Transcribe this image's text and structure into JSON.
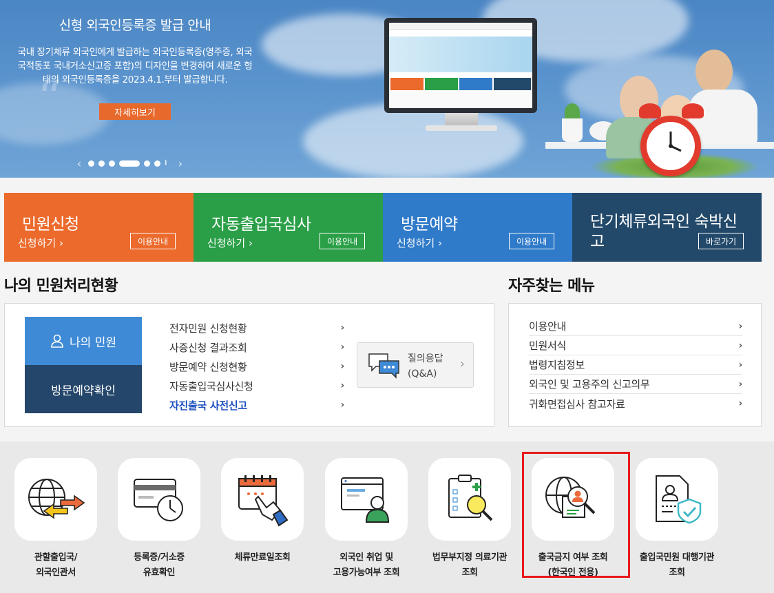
{
  "hero": {
    "title": "신형 외국인등록증 발급 안내",
    "description": "국내 장기체류 외국인에게 발급하는 외국인등록증(영주증, 외국국적동포 국내거소신고증 포함)의 디자인을 변경하여 새로운 형태의 외국인등록증을 2023.4.1.부터 발급합니다.",
    "detail_button": "자세히보기",
    "prev": "‹",
    "next": "›",
    "pause": "ll"
  },
  "tiles": [
    {
      "title": "민원신청",
      "sub": "신청하기 ›",
      "button": "이용안내",
      "color": "#ec6a2c"
    },
    {
      "title": "자동출입국심사",
      "sub": "신청하기 ›",
      "button": "이용안내",
      "color": "#2a9f47"
    },
    {
      "title": "방문예약",
      "sub": "신청하기 ›",
      "button": "이용안내",
      "color": "#2f7ac9"
    },
    {
      "title": "단기체류외국인 숙박신고",
      "button": "바로가기",
      "color": "#23496a"
    }
  ],
  "my_status": {
    "heading": "나의 민원처리현황",
    "my_civil": "나의 민원",
    "visit_confirm": "방문예약확인",
    "links": [
      "전자민원 신청현황",
      "사증신청 결과조회",
      "방문예약 신청현황",
      "자동출입국심사신청",
      "자진출국 사전신고"
    ],
    "qa_title": "질의응답",
    "qa_sub": "(Q&A)"
  },
  "favorites": {
    "heading": "자주찾는 메뉴",
    "links": [
      "이용안내",
      "민원서식",
      "법령지침정보",
      "외국인 및 고용주의 신고의무",
      "귀화면접심사 참고자료"
    ]
  },
  "services": [
    {
      "line1": "관할출입국/",
      "line2": "외국인관서",
      "icon": "globe-arrows-icon"
    },
    {
      "line1": "등록증/거소증",
      "line2": "유효확인",
      "icon": "card-clock-icon"
    },
    {
      "line1": "체류만료일조회",
      "line2": "",
      "icon": "calendar-hand-icon"
    },
    {
      "line1": "외국인 취업 및",
      "line2": "고용가능여부 조회",
      "icon": "browser-person-icon"
    },
    {
      "line1": "법무부지정 의료기관",
      "line2": "조회",
      "icon": "clipboard-magnifier-icon"
    },
    {
      "line1": "출국금지 여부 조회",
      "line2": "(한국인 전용)",
      "icon": "globe-person-magnifier-icon"
    },
    {
      "line1": "출입국민원 대행기관",
      "line2": "조회",
      "icon": "document-shield-icon"
    }
  ]
}
